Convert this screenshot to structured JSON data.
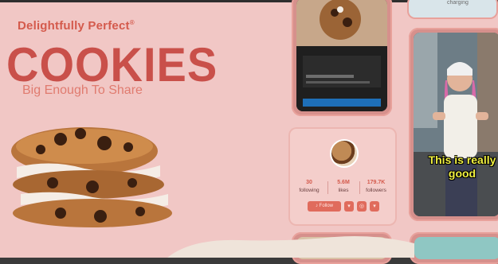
{
  "hero": {
    "tagline": "Delightfully Perfect",
    "tagline_mark": "®",
    "title": "COOKIES",
    "subtitle": "Big Enough To Share"
  },
  "chip": {
    "text": "charging"
  },
  "profile": {
    "stats": [
      {
        "value": "30",
        "label": "following"
      },
      {
        "value": "5.6M",
        "label": "likes"
      },
      {
        "value": "179.7K",
        "label": "followers"
      }
    ],
    "follow_label": "Follow",
    "buttons": [
      "▾",
      "◎",
      "▾"
    ]
  },
  "video_caption": {
    "line1": "This is really",
    "line2": "good"
  },
  "colors": {
    "background": "#f1c7c5",
    "brand_red": "#c9504a",
    "accent": "#e06b5c"
  }
}
